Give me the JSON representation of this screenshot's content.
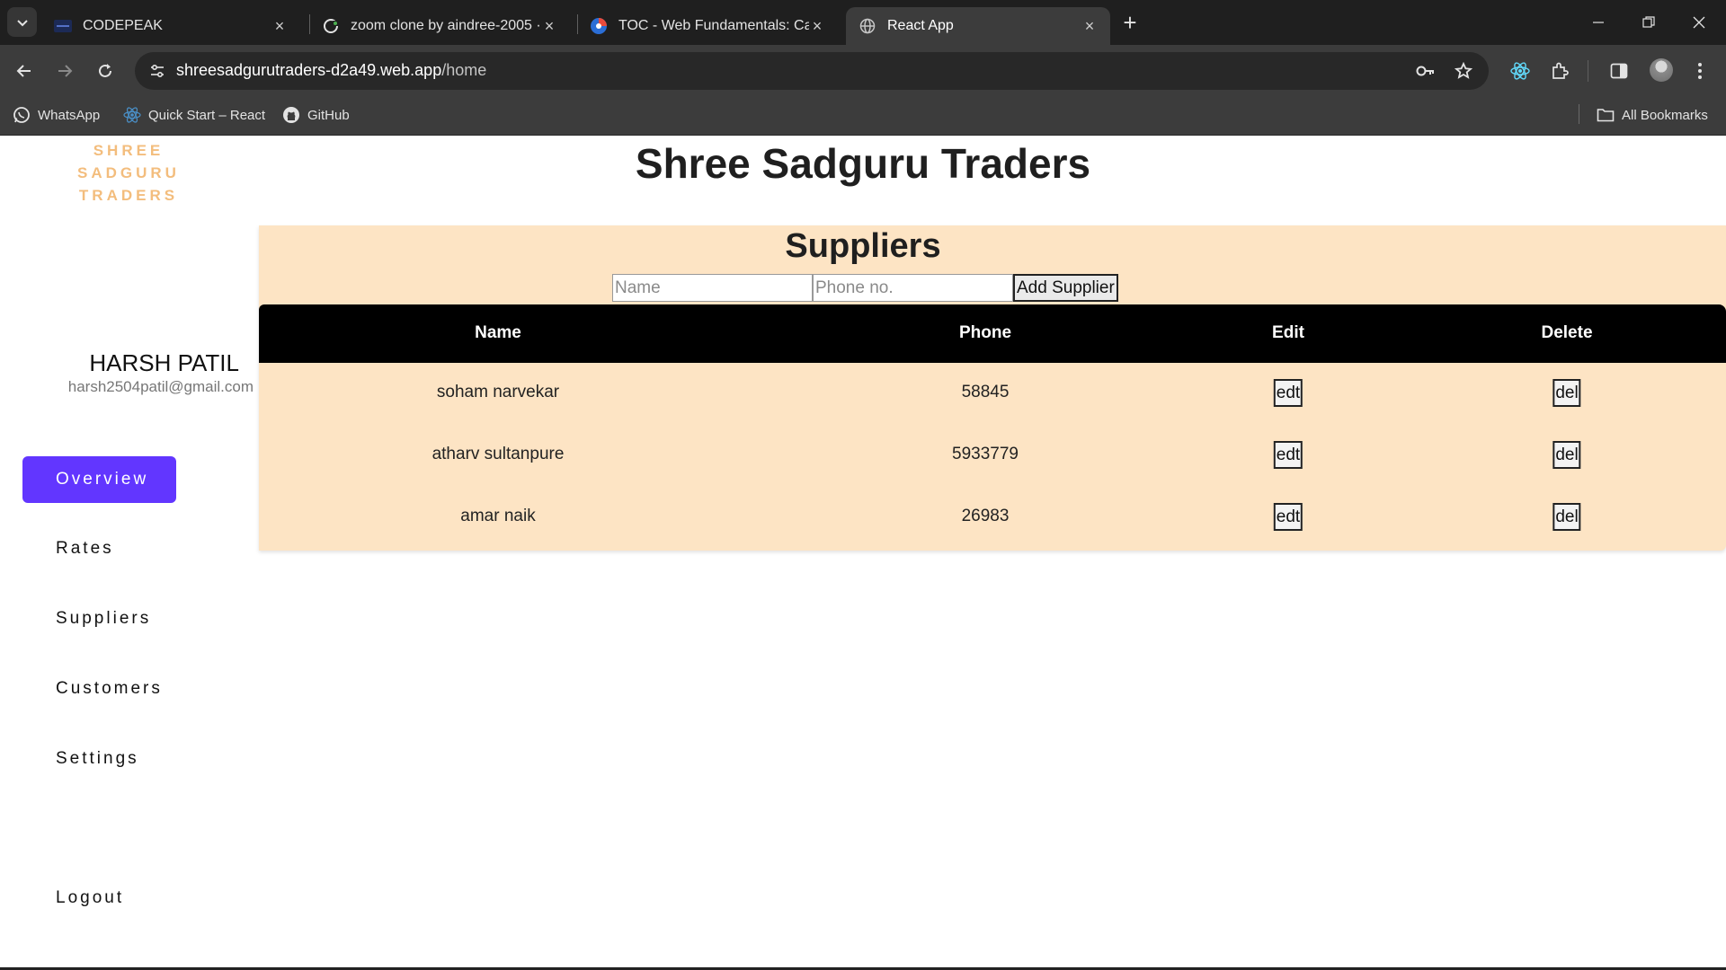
{
  "browser": {
    "tabs": [
      {
        "title": "CODEPEAK",
        "favicon": "codepeak-icon"
      },
      {
        "title": "zoom clone by aindree-2005 · P",
        "favicon": "codesandbox-icon"
      },
      {
        "title": "TOC - Web Fundamentals: Casc",
        "favicon": "course-icon"
      },
      {
        "title": "React App",
        "favicon": "globe-icon",
        "active": true
      }
    ],
    "url_host": "shreesadgurutraders-d2a49.web.app",
    "url_path": "/home",
    "bookmarks": [
      {
        "label": "WhatsApp",
        "icon": "whatsapp-icon"
      },
      {
        "label": "Quick Start – React",
        "icon": "react-icon"
      },
      {
        "label": "GitHub",
        "icon": "github-icon"
      }
    ],
    "all_bookmarks": "All Bookmarks"
  },
  "sidebar": {
    "logo_line1": "SHREE",
    "logo_line2": "SADGURU",
    "logo_line3": "TRADERS",
    "user_name": "HARSH PATIL",
    "user_email": "harsh2504patil@gmail.com",
    "nav": [
      "Overview",
      "Rates",
      "Suppliers",
      "Customers",
      "Settings"
    ],
    "active": "Overview",
    "logout": "Logout"
  },
  "header": {
    "title": "Shree Sadguru Traders"
  },
  "suppliers": {
    "title": "Suppliers",
    "name_placeholder": "Name",
    "phone_placeholder": "Phone no.",
    "add_label": "Add Supplier",
    "columns": [
      "Name",
      "Phone",
      "Edit",
      "Delete"
    ],
    "rows": [
      {
        "name": "soham narvekar",
        "phone": "58845",
        "edit": "edt",
        "delete": "del"
      },
      {
        "name": "atharv sultanpure",
        "phone": "5933779",
        "edit": "edt",
        "delete": "del"
      },
      {
        "name": "amar naik",
        "phone": "26983",
        "edit": "edt",
        "delete": "del"
      }
    ]
  },
  "colors": {
    "accent": "#6236ff",
    "panel": "#fde4c4",
    "logo": "#f3bd7d"
  }
}
